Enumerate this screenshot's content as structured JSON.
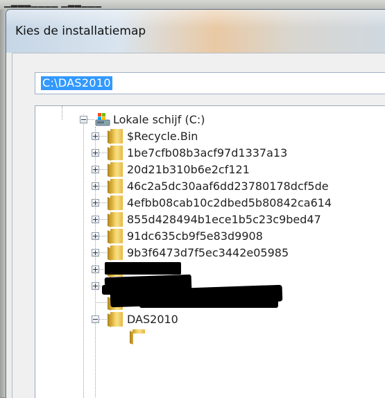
{
  "window": {
    "title": "Kies de installatiemap"
  },
  "path_field": {
    "value": "C:\\DAS2010"
  },
  "tree": {
    "drive": {
      "label": "Lokale schijf (C:)",
      "icon": "drive-icon"
    },
    "folders": [
      {
        "label": "$Recycle.Bin",
        "expanded": false
      },
      {
        "label": "1be7cfb08b3acf97d1337a13",
        "expanded": false
      },
      {
        "label": "20d21b310b6e2cf121",
        "expanded": false
      },
      {
        "label": "46c2a5dc30aaf6dd23780178dcf5de",
        "expanded": false
      },
      {
        "label": "4efbb08cab10c2dbed5b80842ca614",
        "expanded": false
      },
      {
        "label": "855d428494b1ece1b5c23c9bed47",
        "expanded": false
      },
      {
        "label": "91dc635cb9f5e83d9908",
        "expanded": false
      },
      {
        "label": "9b3f6473d7f5ec3442e05985",
        "expanded": false
      },
      {
        "label": "",
        "expanded": false,
        "redacted": true
      },
      {
        "label": "",
        "expanded": false,
        "redacted": true
      },
      {
        "label": "",
        "expanded": false,
        "redacted": true
      },
      {
        "label": "DAS2010",
        "expanded": true
      }
    ]
  },
  "colors": {
    "selection": "#3399ff",
    "folder": "#f2cf5d"
  }
}
